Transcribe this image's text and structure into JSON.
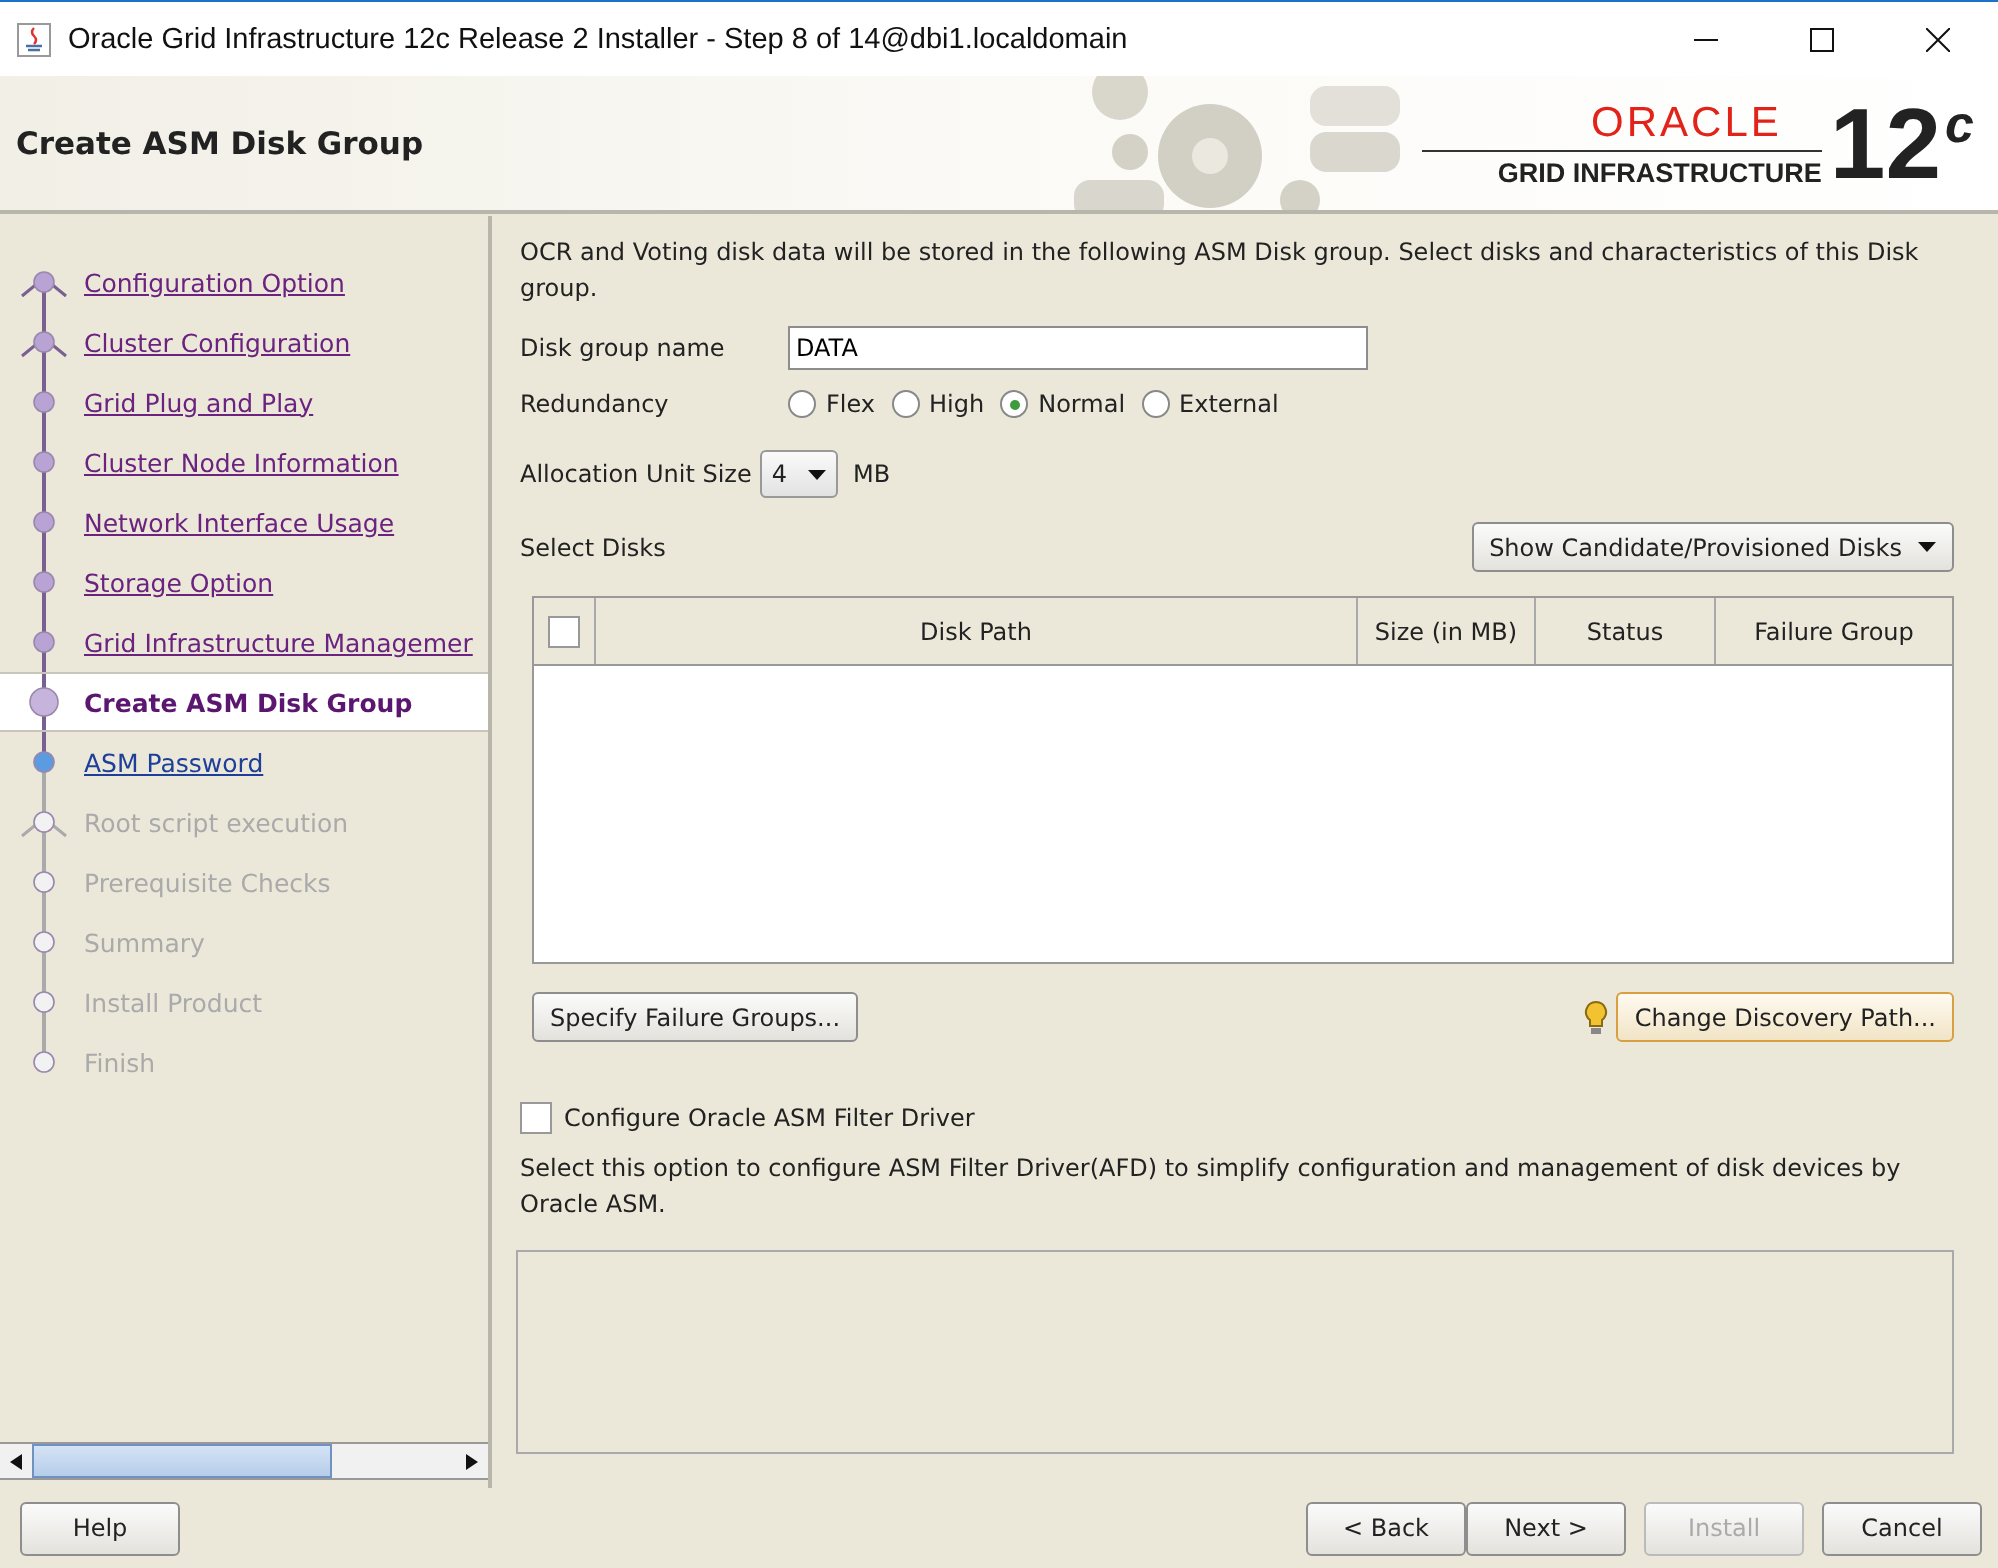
{
  "window": {
    "title": "Oracle Grid Infrastructure 12c Release 2 Installer - Step 8 of 14@dbi1.localdomain"
  },
  "header": {
    "title": "Create ASM Disk Group",
    "logo": {
      "brand": "ORACLE",
      "product": "GRID INFRASTRUCTURE",
      "version": "12",
      "version_sup": "c"
    }
  },
  "steps": [
    {
      "label": "Configuration Option",
      "kind": "done",
      "branch": true
    },
    {
      "label": "Cluster Configuration",
      "kind": "done",
      "branch": true
    },
    {
      "label": "Grid Plug and Play",
      "kind": "done",
      "branch": false
    },
    {
      "label": "Cluster Node Information",
      "kind": "done",
      "branch": false
    },
    {
      "label": "Network Interface Usage",
      "kind": "done",
      "branch": false
    },
    {
      "label": "Storage Option",
      "kind": "done",
      "branch": false
    },
    {
      "label": "Grid Infrastructure Managemer",
      "kind": "done",
      "branch": false
    },
    {
      "label": "Create ASM Disk Group",
      "kind": "current",
      "branch": false
    },
    {
      "label": "ASM Password",
      "kind": "next",
      "branch": false
    },
    {
      "label": "Root script execution",
      "kind": "pending",
      "branch": true
    },
    {
      "label": "Prerequisite Checks",
      "kind": "pending",
      "branch": false
    },
    {
      "label": "Summary",
      "kind": "pending",
      "branch": false
    },
    {
      "label": "Install Product",
      "kind": "pending",
      "branch": false
    },
    {
      "label": "Finish",
      "kind": "pending",
      "branch": false
    }
  ],
  "content": {
    "intro": "OCR and Voting disk data will be stored in the following ASM Disk group. Select disks and characteristics of this Disk group.",
    "disk_group_name": {
      "label": "Disk group name",
      "value": "DATA"
    },
    "redundancy": {
      "label": "Redundancy",
      "options": [
        {
          "label": "Flex",
          "selected": false
        },
        {
          "label": "High",
          "selected": false
        },
        {
          "label": "Normal",
          "selected": true
        },
        {
          "label": "External",
          "selected": false
        }
      ]
    },
    "allocation_unit": {
      "label": "Allocation Unit Size",
      "value": "4",
      "unit": "MB"
    },
    "select_disks": {
      "label": "Select Disks",
      "filter": "Show Candidate/Provisioned Disks"
    },
    "table": {
      "select_all_checked": false,
      "columns": [
        "Disk Path",
        "Size (in MB)",
        "Status",
        "Failure Group"
      ]
    },
    "specify_failure_groups": "Specify Failure Groups...",
    "change_discovery_path": "Change Discovery Path...",
    "afd": {
      "label": "Configure Oracle ASM Filter Driver",
      "checked": false,
      "description": "Select this option to configure ASM Filter Driver(AFD) to simplify configuration and management of disk devices by Oracle ASM."
    }
  },
  "buttons": {
    "help": {
      "label": "Help",
      "disabled": false
    },
    "back": {
      "label": "< Back",
      "disabled": false
    },
    "next": {
      "label": "Next >",
      "disabled": false
    },
    "install": {
      "label": "Install",
      "disabled": true
    },
    "cancel": {
      "label": "Cancel",
      "disabled": false
    }
  }
}
